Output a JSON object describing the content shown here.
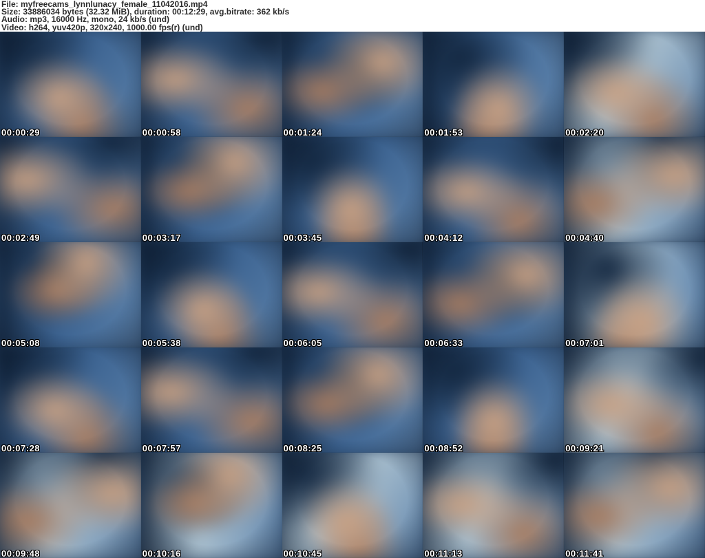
{
  "header": {
    "file_line": "File: myfreecams_lynnlunacy_female_11042016.mp4",
    "size_line": "Size: 33886034 bytes (32.32 MiB), duration: 00:12:29, avg.bitrate: 362 kb/s",
    "audio_line": "Audio: mp3, 16000 Hz, mono, 24 kb/s (und)",
    "video_line": "Video: h264, yuv420p, 320x240, 1000.00 fps(r) (und)"
  },
  "palette": {
    "wall_blue": "#3c6391",
    "wall_blue_light": "#5c82ab",
    "bedding_grey": "#a9bfce",
    "shadow_navy": "#132740",
    "warm_tone": "#c9a183",
    "warm_deep": "#a97c5f",
    "dark_hair": "#221b1a",
    "timestamp_text": "#ffffff",
    "header_bg": "#ffffff",
    "header_text": "#2b2b2b"
  },
  "thumbnails": [
    {
      "time": "00:00:29",
      "wall": "#3a5f8c",
      "shadow": "#122richless"
    },
    {
      "time": "00:00:58"
    },
    {
      "time": "00:01:24"
    },
    {
      "time": "00:01:53"
    },
    {
      "time": "00:02:20"
    },
    {
      "time": "00:02:49"
    },
    {
      "time": "00:03:17"
    },
    {
      "time": "00:03:45"
    },
    {
      "time": "00:04:12"
    },
    {
      "time": "00:04:40"
    },
    {
      "time": "00:05:08"
    },
    {
      "time": "00:05:38"
    },
    {
      "time": "00:06:05"
    },
    {
      "time": "00:06:33"
    },
    {
      "time": "00:07:01"
    },
    {
      "time": "00:07:28"
    },
    {
      "time": "00:07:57"
    },
    {
      "time": "00:08:25"
    },
    {
      "time": "00:08:52"
    },
    {
      "time": "00:09:21"
    },
    {
      "time": "00:09:48"
    },
    {
      "time": "00:10:16"
    },
    {
      "time": "00:10:45"
    },
    {
      "time": "00:11:13"
    },
    {
      "time": "00:11:41"
    }
  ]
}
